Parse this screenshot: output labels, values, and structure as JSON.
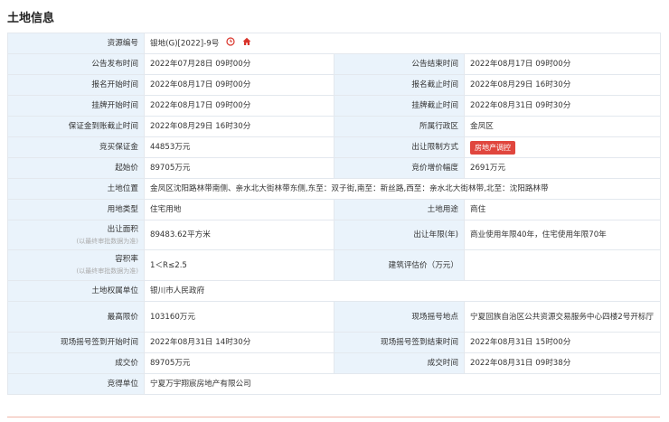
{
  "page": {
    "title": "土地信息"
  },
  "labels": {
    "resource_no": "资源编号",
    "announce_start": "公告发布时间",
    "announce_end": "公告结束时间",
    "signup_start": "报名开始时间",
    "signup_end": "报名截止时间",
    "listing_start": "挂牌开始时间",
    "listing_end": "挂牌截止时间",
    "deposit_deadline": "保证金到账截止时间",
    "district": "所属行政区",
    "deposit": "竞买保证金",
    "restriction": "出让限制方式",
    "start_price": "起始价",
    "increment": "竞价增价幅度",
    "location": "土地位置",
    "land_type": "用地类型",
    "land_use": "土地用途",
    "area": "出让面积",
    "area_note": "(以最终审批数据为准)",
    "term": "出让年限(年)",
    "far": "容积率",
    "far_note": "(以最终审批数据为准)",
    "building_price": "建筑评估价（万元）",
    "owner": "土地权属单位",
    "max_price": "最高限价",
    "lottery_place": "现场摇号地点",
    "lottery_start": "现场摇号签到开始时间",
    "lottery_end": "现场摇号签到结束时间",
    "deal_price": "成交价",
    "deal_time": "成交时间",
    "winner": "竞得单位"
  },
  "values": {
    "resource_no": "银地(G)[2022]-9号",
    "announce_start": "2022年07月28日 09时00分",
    "announce_end": "2022年08月17日 09时00分",
    "signup_start": "2022年08月17日 09时00分",
    "signup_end": "2022年08月29日 16时30分",
    "listing_start": "2022年08月17日 09时00分",
    "listing_end": "2022年08月31日 09时30分",
    "deposit_deadline": "2022年08月29日 16时30分",
    "district": "金凤区",
    "deposit": "44853万元",
    "restriction": "房地产调控",
    "start_price": "89705万元",
    "increment": "2691万元",
    "location": "金凤区沈阳路林带南侧、亲水北大街林带东侧,东至：双子街,南至：新丝路,西至：亲水北大街林带,北至：沈阳路林带",
    "land_type": "住宅用地",
    "land_use": "商住",
    "area": "89483.62平方米",
    "term": "商业使用年限40年，住宅使用年限70年",
    "far": "1＜R≤2.5",
    "building_price": "",
    "owner": "银川市人民政府",
    "max_price": "103160万元",
    "lottery_place": "宁夏回族自治区公共资源交易服务中心四楼2号开标厅",
    "lottery_start": "2022年08月31日 14时30分",
    "lottery_end": "2022年08月31日 15时00分",
    "deal_price": "89705万元",
    "deal_time": "2022年08月31日 09时38分",
    "winner": "宁夏万宇翔宸房地产有限公司"
  },
  "icons": {
    "clock": "clock-icon",
    "home": "home-icon"
  },
  "colors": {
    "label_bg": "#eaf3fb",
    "badge": "#e0463e",
    "accent_red": "#d9342b"
  }
}
